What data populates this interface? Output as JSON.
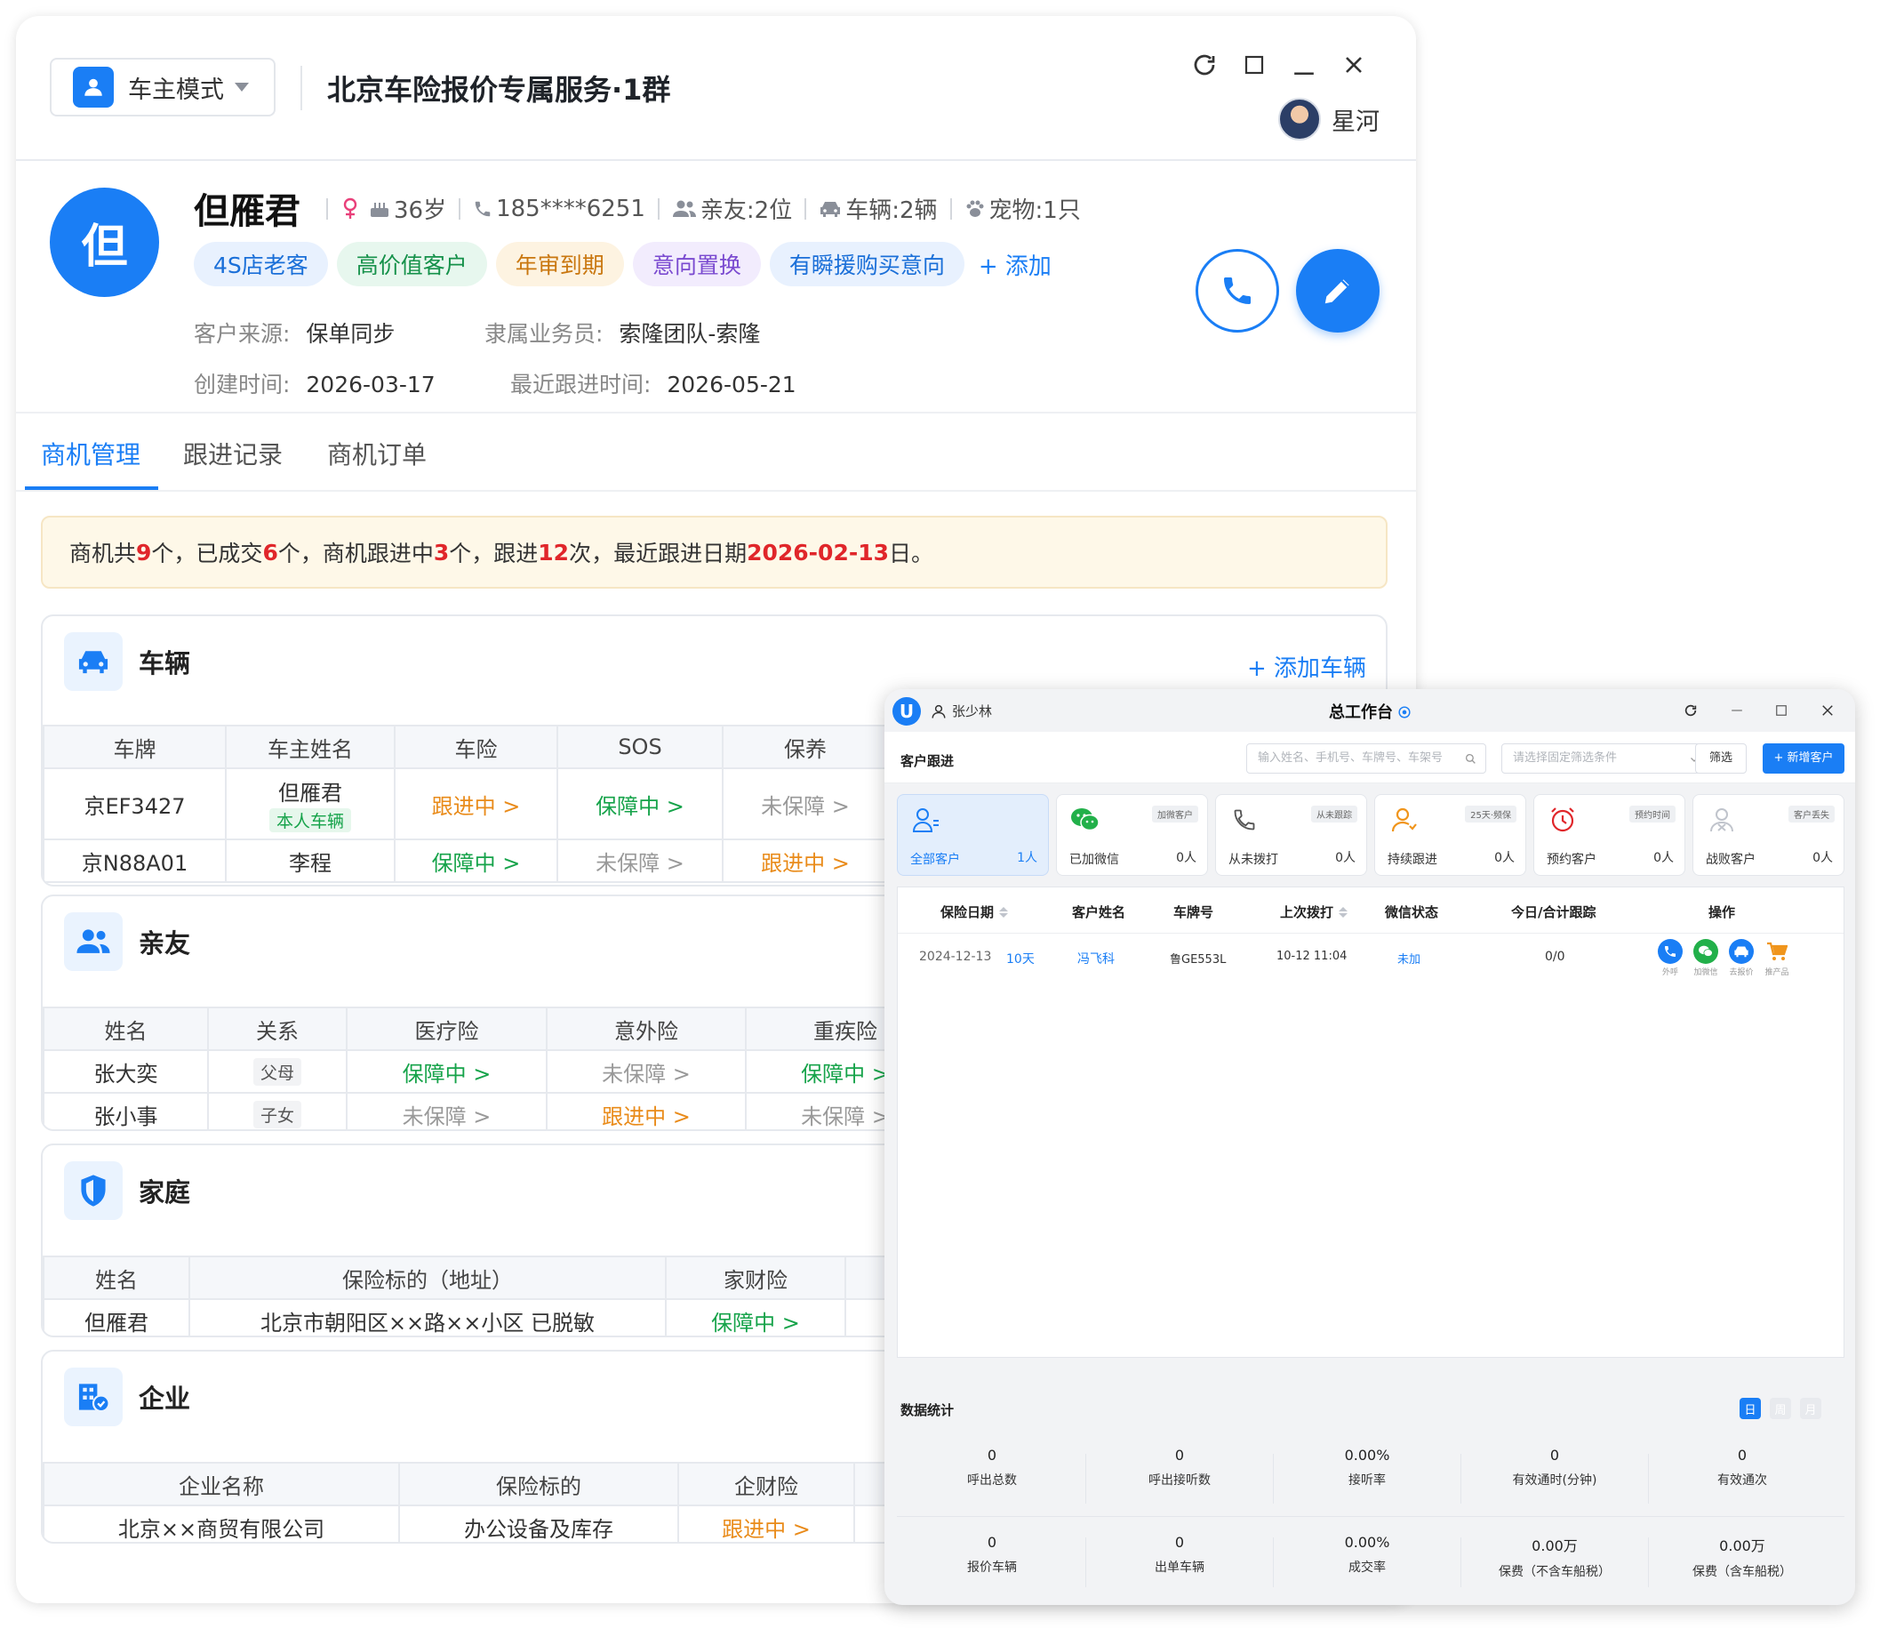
{
  "main": {
    "mode_label": "车主模式",
    "group_title": "北京车险报价专属服务·1群",
    "agent_name": "星河",
    "customer": {
      "avatar_char": "但",
      "name": "但雁君",
      "age": "36岁",
      "phone": "185****6251",
      "friends": "亲友:2位",
      "vehicles": "车辆:2辆",
      "pets": "宠物:1只",
      "tags": [
        "4S店老客",
        "高价值客户",
        "年审到期",
        "意向置换",
        "有瞬援购买意向"
      ],
      "add_tag": "+ 添加",
      "source_label": "客户来源:",
      "source_value": "保单同步",
      "salesperson_label": "隶属业务员:",
      "salesperson_value": "索隆团队-索隆",
      "created_label": "创建时间:",
      "created_value": "2026-03-17",
      "followup_label": "最近跟进时间:",
      "followup_value": "2026-05-21"
    },
    "tabs": [
      "商机管理",
      "跟进记录",
      "商机订单"
    ],
    "summary": {
      "t1": "商机共",
      "n1": "9",
      "t2": "个，已成交",
      "n2": "6",
      "t3": "个，商机跟进中",
      "n3": "3",
      "t4": "个，跟进",
      "n4": "12",
      "t5": "次，最近跟进日期",
      "n5": "2026-02-13",
      "t6": "日。"
    },
    "vehicle_card": {
      "title": "车辆",
      "add": "+ 添加车辆",
      "headers": [
        "车牌",
        "车主姓名",
        "车险",
        "SOS",
        "保养"
      ],
      "rows": [
        {
          "plate": "京EF3427",
          "owner": "但雁君",
          "owner_badge": "本人车辆",
          "insurance": "跟进中 >",
          "sos": "保障中 >",
          "maint": "未保障 >"
        },
        {
          "plate": "京N88A01",
          "owner": "李程",
          "owner_badge": "",
          "insurance": "保障中 >",
          "sos": "未保障 >",
          "maint": "跟进中 >"
        }
      ]
    },
    "friends_card": {
      "title": "亲友",
      "headers": [
        "姓名",
        "关系",
        "医疗险",
        "意外险",
        "重疾险"
      ],
      "rows": [
        {
          "name": "张大奕",
          "rel": "父母",
          "medical": "保障中 >",
          "accident": "未保障 >",
          "critical": "保障中 >"
        },
        {
          "name": "张小事",
          "rel": "子女",
          "medical": "未保障 >",
          "accident": "跟进中 >",
          "critical": "未保障 >"
        }
      ]
    },
    "home_card": {
      "title": "家庭",
      "headers": [
        "姓名",
        "保险标的（地址）",
        "家财险"
      ],
      "rows": [
        {
          "name": "但雁君",
          "address": "北京市朝阳区××路××小区 已脱敏",
          "property": "保障中 >"
        }
      ]
    },
    "company_card": {
      "title": "企业",
      "headers": [
        "企业名称",
        "保险标的",
        "企财险"
      ],
      "rows": [
        {
          "name": "北京××商贸有限公司",
          "subject": "办公设备及库存",
          "property": "跟进中 >"
        }
      ]
    }
  },
  "workbench": {
    "user": "张少林",
    "title": "总工作台",
    "section": "客户跟进",
    "search_placeholder": "输入姓名、手机号、车牌号、车架号",
    "filter_placeholder": "请选择固定筛选条件",
    "filter_btn": "筛选",
    "new_btn": "+ 新增客户",
    "cards": [
      {
        "label": "全部客户",
        "count": "1人",
        "badge": "",
        "icon": "person-list-icon"
      },
      {
        "label": "已加微信",
        "count": "0人",
        "badge": "加微客户",
        "icon": "wechat-icon"
      },
      {
        "label": "从未拨打",
        "count": "0人",
        "badge": "从未跟踪",
        "icon": "phone-icon"
      },
      {
        "label": "持续跟进",
        "count": "0人",
        "badge": "25天·频保",
        "icon": "person-icon"
      },
      {
        "label": "预约客户",
        "count": "0人",
        "badge": "预约时间",
        "icon": "alarm-icon"
      },
      {
        "label": "战败客户",
        "count": "0人",
        "badge": "客户丢失",
        "icon": "person-x-icon"
      }
    ],
    "table_headers": [
      "保险日期",
      "客户姓名",
      "车牌号",
      "上次拨打",
      "微信状态",
      "今日/合计跟踪",
      "操作"
    ],
    "row": {
      "date": "2024-12-13",
      "days": "10天",
      "name": "冯飞科",
      "plate": "鲁GE553L",
      "last_call": "10-12 11:04",
      "wechat": "未加",
      "track": "0/0",
      "ops": [
        "外呼",
        "加微信",
        "去报价",
        "推产品"
      ]
    },
    "stats_title": "数据统计",
    "periods": [
      "日",
      "周",
      "月"
    ],
    "stats": [
      {
        "value": "0",
        "label": "呼出总数"
      },
      {
        "value": "0",
        "label": "呼出接听数"
      },
      {
        "value": "0.00%",
        "label": "接听率"
      },
      {
        "value": "0",
        "label": "有效通时(分钟)"
      },
      {
        "value": "0",
        "label": "有效通次"
      },
      {
        "value": "0",
        "label": "报价车辆"
      },
      {
        "value": "0",
        "label": "出单车辆"
      },
      {
        "value": "0.00%",
        "label": "成交率"
      },
      {
        "value": "0.00万",
        "label": "保费（不含车船税）"
      },
      {
        "value": "0.00万",
        "label": "保费（含车船税）"
      }
    ]
  },
  "colors": {
    "accent": "#1a7ef5",
    "green": "#16a34a",
    "orange": "#e98b1a",
    "gray": "#999999",
    "red": "#e0262a"
  }
}
